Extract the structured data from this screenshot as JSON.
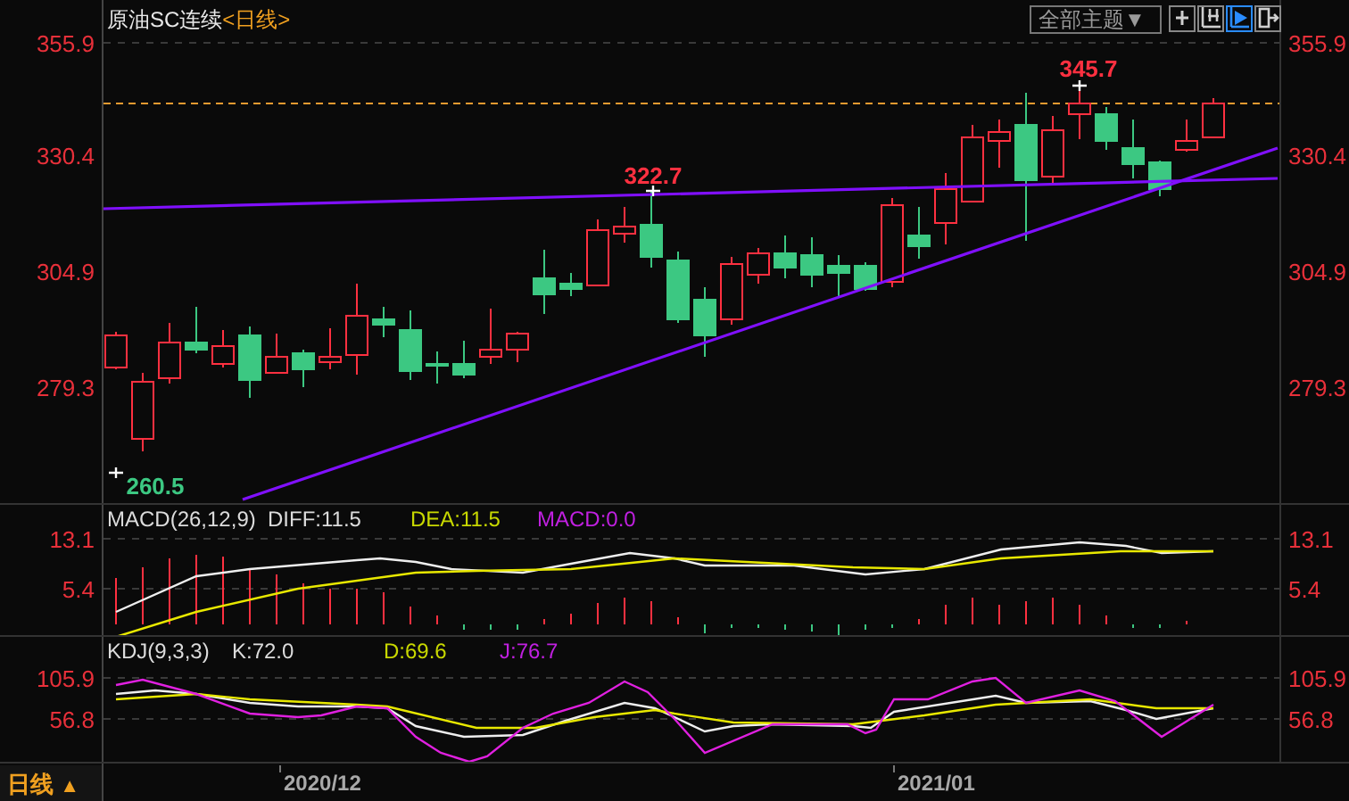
{
  "header": {
    "title": "原油SC连续",
    "period": "<日线>"
  },
  "toolbar": {
    "theme_dropdown": "全部主题",
    "dropdown_arrow": "▼",
    "tools": [
      {
        "kind": "crosshair",
        "selected": false
      },
      {
        "kind": "range",
        "selected": false
      },
      {
        "kind": "play",
        "selected": true
      },
      {
        "kind": "export",
        "selected": false
      }
    ]
  },
  "price_panel": {
    "left_axis": [
      "355.9",
      "330.4",
      "304.9",
      "279.3"
    ],
    "right_axis": [
      "355.9",
      "330.4",
      "304.9",
      "279.3"
    ],
    "annotations": [
      {
        "text": "345.7",
        "kind": "high"
      },
      {
        "text": "322.7",
        "kind": "high"
      },
      {
        "text": "260.5",
        "kind": "low"
      }
    ]
  },
  "macd_panel": {
    "name": "MACD(26,12,9)",
    "readings": [
      {
        "text": "DIFF:11.5",
        "color": "#dcdcdc"
      },
      {
        "text": "DEA:11.5",
        "color": "#c8d800"
      },
      {
        "text": "MACD:0.0",
        "color": "#c020e0"
      }
    ],
    "left_axis": [
      "13.1",
      "5.4"
    ],
    "right_axis": [
      "13.1",
      "5.4"
    ]
  },
  "kdj_panel": {
    "name": "KDJ(9,3,3)",
    "readings": [
      {
        "text": "K:72.0",
        "color": "#dcdcdc"
      },
      {
        "text": "D:69.6",
        "color": "#c8d800"
      },
      {
        "text": "J:76.7",
        "color": "#c020e0"
      }
    ],
    "left_axis": [
      "105.9",
      "56.8"
    ],
    "right_axis": [
      "105.9",
      "56.8"
    ]
  },
  "footer": {
    "period": "日线",
    "arrow": "▲",
    "dates": [
      "2020/12",
      "2021/01"
    ]
  }
}
